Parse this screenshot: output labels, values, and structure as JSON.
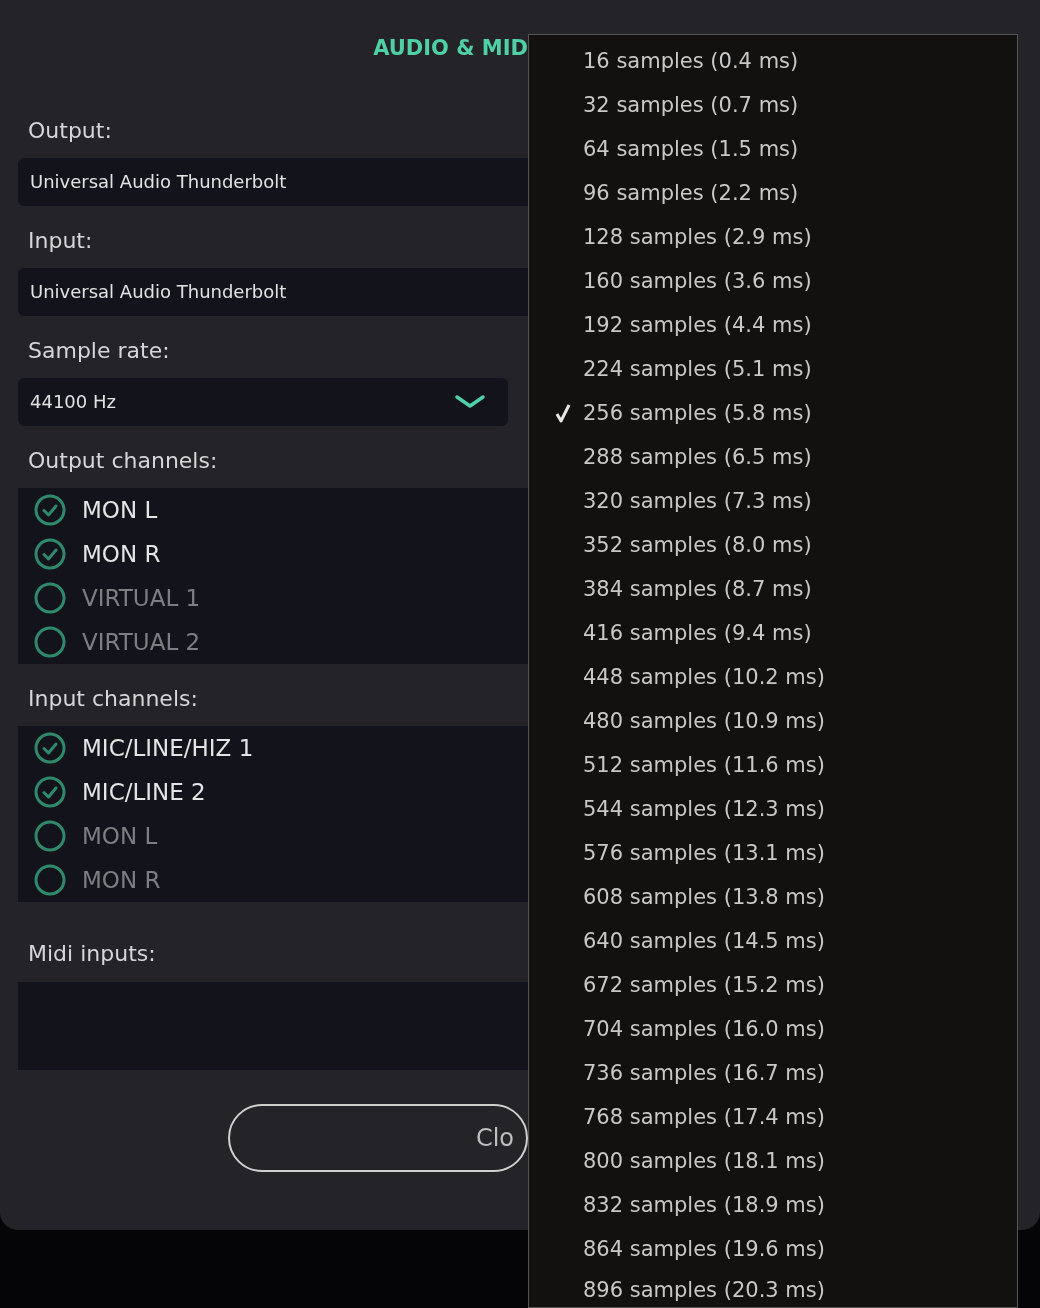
{
  "dialog": {
    "title": "AUDIO & MID",
    "output": {
      "label": "Output:",
      "value": "Universal Audio Thunderbolt"
    },
    "input": {
      "label": "Input:",
      "value": "Universal Audio Thunderbolt"
    },
    "sample_rate": {
      "label": "Sample rate:",
      "value": "44100 Hz"
    },
    "output_channels": {
      "label": "Output channels:",
      "items": [
        {
          "name": "MON L",
          "checked": true
        },
        {
          "name": "MON R",
          "checked": true
        },
        {
          "name": "VIRTUAL 1",
          "checked": false
        },
        {
          "name": "VIRTUAL 2",
          "checked": false
        }
      ]
    },
    "input_channels": {
      "label": "Input channels:",
      "items": [
        {
          "name": "MIC/LINE/HIZ 1",
          "checked": true
        },
        {
          "name": "MIC/LINE 2",
          "checked": true
        },
        {
          "name": "MON L",
          "checked": false
        },
        {
          "name": "MON R",
          "checked": false
        }
      ]
    },
    "midi_inputs": {
      "label": "Midi inputs:"
    },
    "close_button": "Clo"
  },
  "buffer_menu": {
    "items": [
      {
        "label": "16 samples (0.4 ms)",
        "selected": false
      },
      {
        "label": "32 samples (0.7 ms)",
        "selected": false
      },
      {
        "label": "64 samples (1.5 ms)",
        "selected": false
      },
      {
        "label": "96 samples (2.2 ms)",
        "selected": false
      },
      {
        "label": "128 samples (2.9 ms)",
        "selected": false
      },
      {
        "label": "160 samples (3.6 ms)",
        "selected": false
      },
      {
        "label": "192 samples (4.4 ms)",
        "selected": false
      },
      {
        "label": "224 samples (5.1 ms)",
        "selected": false
      },
      {
        "label": "256 samples (5.8 ms)",
        "selected": true
      },
      {
        "label": "288 samples (6.5 ms)",
        "selected": false
      },
      {
        "label": "320 samples (7.3 ms)",
        "selected": false
      },
      {
        "label": "352 samples (8.0 ms)",
        "selected": false
      },
      {
        "label": "384 samples (8.7 ms)",
        "selected": false
      },
      {
        "label": "416 samples (9.4 ms)",
        "selected": false
      },
      {
        "label": "448 samples (10.2 ms)",
        "selected": false
      },
      {
        "label": "480 samples (10.9 ms)",
        "selected": false
      },
      {
        "label": "512 samples (11.6 ms)",
        "selected": false
      },
      {
        "label": "544 samples (12.3 ms)",
        "selected": false
      },
      {
        "label": "576 samples (13.1 ms)",
        "selected": false
      },
      {
        "label": "608 samples (13.8 ms)",
        "selected": false
      },
      {
        "label": "640 samples (14.5 ms)",
        "selected": false
      },
      {
        "label": "672 samples (15.2 ms)",
        "selected": false
      },
      {
        "label": "704 samples (16.0 ms)",
        "selected": false
      },
      {
        "label": "736 samples (16.7 ms)",
        "selected": false
      },
      {
        "label": "768 samples (17.4 ms)",
        "selected": false
      },
      {
        "label": "800 samples (18.1 ms)",
        "selected": false
      },
      {
        "label": "832 samples (18.9 ms)",
        "selected": false
      },
      {
        "label": "864 samples (19.6 ms)",
        "selected": false
      },
      {
        "label": "896 samples (20.3 ms)",
        "selected": false
      }
    ]
  }
}
